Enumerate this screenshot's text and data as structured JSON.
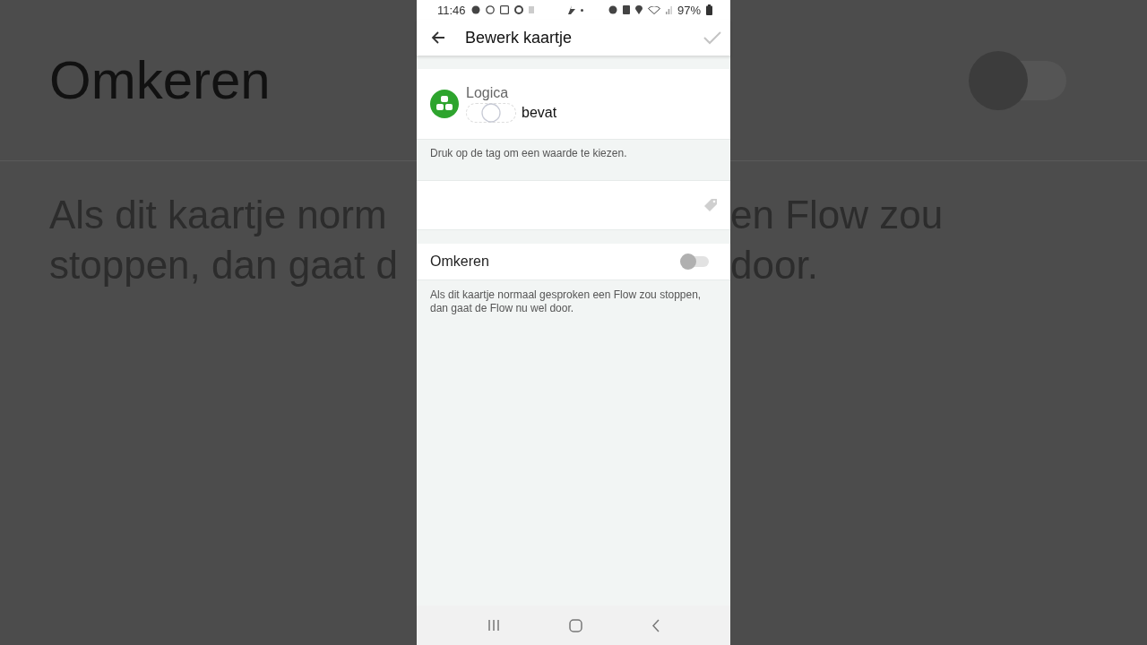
{
  "backdrop": {
    "title": "Omkeren",
    "toggle_on": false,
    "left_lines": [
      "Als dit kaartje norm",
      "stoppen, dan gaat d"
    ],
    "right_lines": [
      "en Flow zou",
      "door."
    ]
  },
  "status_bar": {
    "time": "11:46",
    "battery": "97%"
  },
  "app_bar": {
    "title": "Bewerk kaartje"
  },
  "card": {
    "category": "Logica",
    "condition": "bevat",
    "hint": "Druk op de tag om een waarde te kiezen."
  },
  "invert": {
    "label": "Omkeren",
    "on": false,
    "description": "Als dit kaartje normaal gesproken een Flow zou stoppen, dan gaat de Flow nu wel door."
  }
}
